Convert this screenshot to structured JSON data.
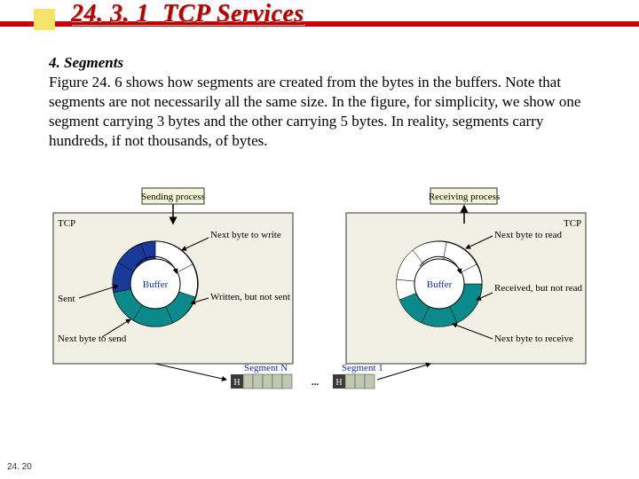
{
  "header": {
    "section_number": "24. 3. 1",
    "section_title": "TCP Services"
  },
  "body": {
    "subheading": "4. Segments",
    "paragraph": "Figure 24. 6 shows how segments are created from the bytes in the buffers. Note that segments are not necessarily all the same size. In the figure, for simplicity, we show one segment carrying 3 bytes and the other carrying 5 bytes. In reality, segments carry hundreds, if not thousands, of bytes."
  },
  "figure": {
    "left": {
      "box": "TCP",
      "process": "Sending process",
      "center": "Buffer",
      "annot_top": "Next byte to write",
      "annot_right": "Written, but not sent",
      "annot_left_top": "Sent",
      "annot_left_bot": "Next byte to send"
    },
    "right": {
      "box": "TCP",
      "process": "Receiving process",
      "center": "Buffer",
      "annot_top": "Next byte to read",
      "annot_right1": "Received, but not read",
      "annot_right2": "Next byte to receive"
    },
    "segments": {
      "left_label": "Segment N",
      "right_label": "Segment 1",
      "header": "H",
      "dots": "..."
    }
  },
  "page_number": "24. 20",
  "chart_data": {
    "type": "table",
    "title": "TCP Segments formed from buffer bytes (Figure 24.6)",
    "segments": [
      {
        "name": "Segment N",
        "payload_bytes": 5,
        "has_header": true
      },
      {
        "name": "Segment 1",
        "payload_bytes": 3,
        "has_header": true
      }
    ],
    "note": "One segment carries 3 bytes and the other carries 5 bytes; real segments carry hundreds to thousands of bytes.",
    "buffers": {
      "sending": {
        "states": [
          "Sent",
          "Written, but not sent",
          "empty"
        ],
        "pointers": [
          "Next byte to write",
          "Next byte to send"
        ]
      },
      "receiving": {
        "states": [
          "Received, but not read",
          "empty"
        ],
        "pointers": [
          "Next byte to read",
          "Next byte to receive"
        ]
      }
    }
  }
}
